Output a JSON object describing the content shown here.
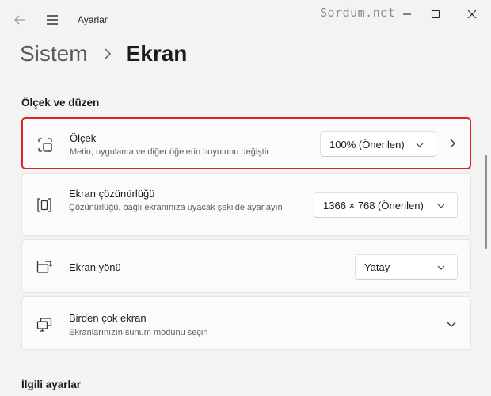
{
  "titlebar": {
    "title": "Ayarlar",
    "watermark": "Sordum.net",
    "icons": {
      "back": "back-arrow-icon",
      "menu": "hamburger-menu-icon",
      "minimize": "minimize-icon",
      "maximize": "maximize-icon",
      "close": "close-icon"
    }
  },
  "breadcrumb": {
    "parent": "Sistem",
    "current": "Ekran"
  },
  "sections": {
    "scale_layout": "Ölçek ve düzen",
    "related": "İlgili ayarlar"
  },
  "settings": {
    "scale": {
      "title": "Ölçek",
      "description": "Metin, uygulama ve diğer öğelerin boyutunu değiştir",
      "value": "100% (Önerilen)",
      "icon": "scale-icon"
    },
    "resolution": {
      "title": "Ekran çözünürlüğü",
      "description": "Çözünürlüğü, bağlı ekranınıza uyacak şekilde ayarlayın",
      "value": "1366 × 768 (Önerilen)",
      "icon": "resolution-icon"
    },
    "orientation": {
      "title": "Ekran yönü",
      "value": "Yatay",
      "icon": "orientation-icon"
    },
    "multiple": {
      "title": "Birden çok ekran",
      "description": "Ekranlarınızın sunum modunu seçin",
      "icon": "multiple-displays-icon"
    }
  },
  "colors": {
    "highlight": "#e0202a",
    "background": "#f3f3f3",
    "card": "#fbfbfb"
  }
}
